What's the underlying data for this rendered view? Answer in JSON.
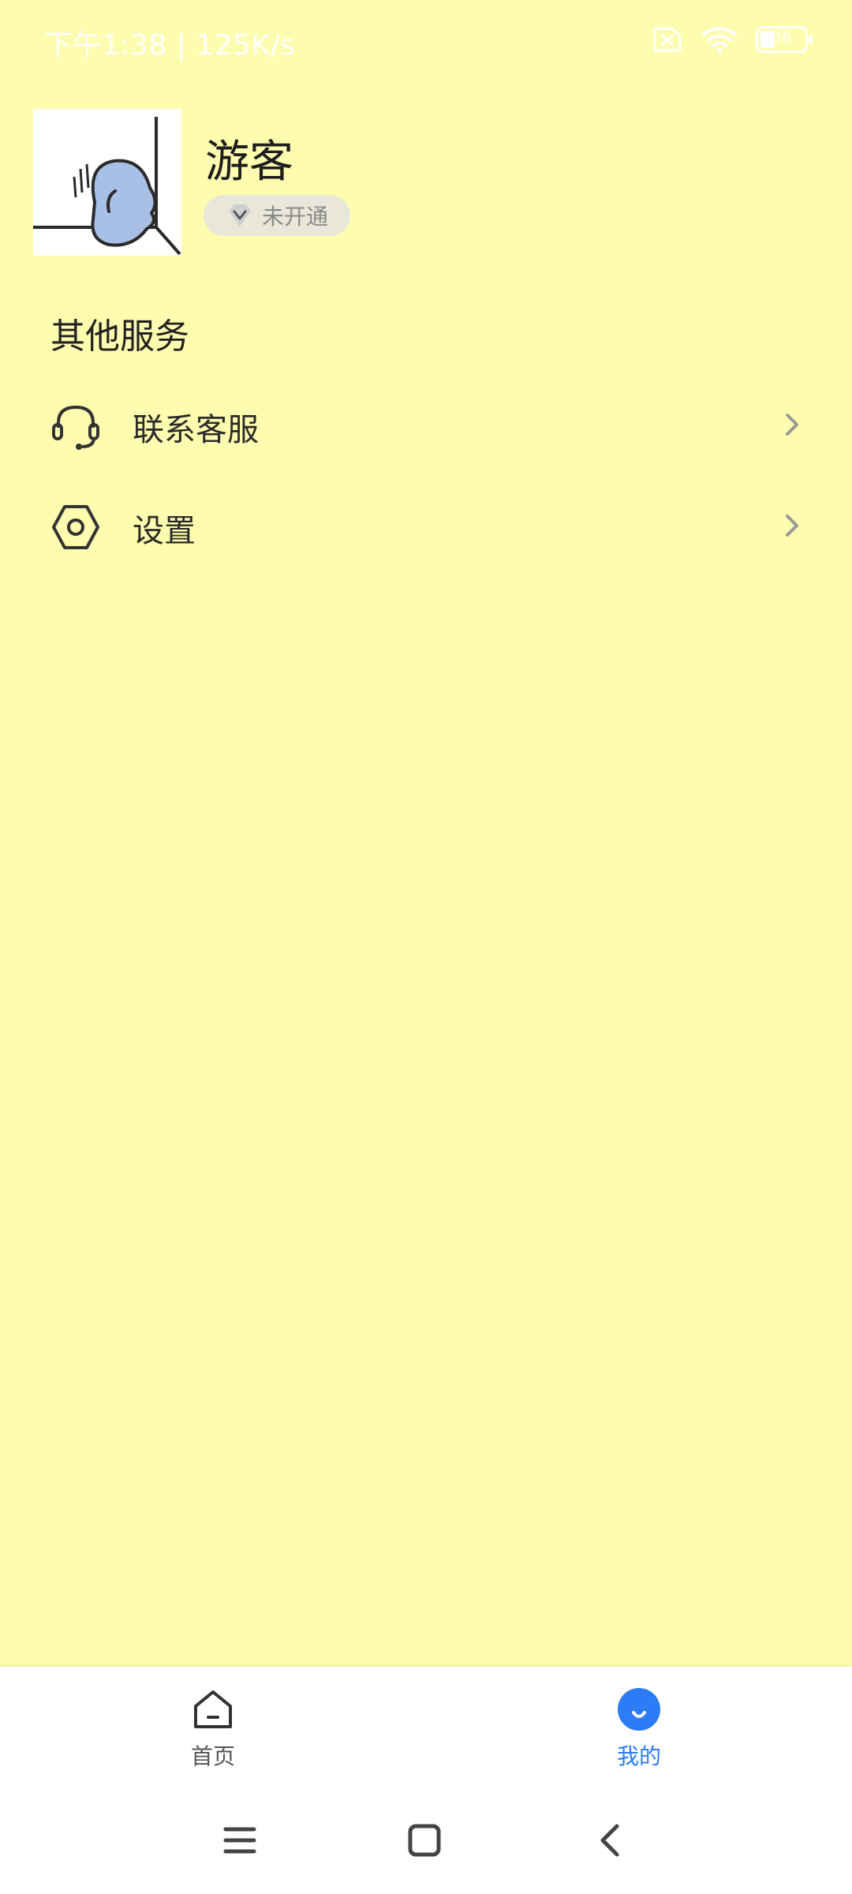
{
  "status_bar": {
    "time_speed": "下午1:38 | 125K/s",
    "battery_level": "36",
    "icons": [
      "sim-off-icon",
      "wifi-icon",
      "battery-icon"
    ]
  },
  "profile": {
    "username": "游客",
    "vip_status": "未开通",
    "vip_icon": "diamond-icon"
  },
  "services": {
    "title": "其他服务",
    "items": [
      {
        "label": "联系客服",
        "icon": "headset-icon"
      },
      {
        "label": "设置",
        "icon": "settings-hexagon-icon"
      }
    ]
  },
  "tabbar": {
    "tabs": [
      {
        "label": "首页",
        "icon": "home-icon",
        "active": false
      },
      {
        "label": "我的",
        "icon": "profile-icon",
        "active": true
      }
    ],
    "active_color": "#2B7CF6",
    "inactive_color": "#555555"
  },
  "nav_bar": {
    "buttons": [
      "menu-icon",
      "home-square-icon",
      "back-icon"
    ]
  },
  "colors": {
    "background": "#FEFCAE",
    "avatar_blob": "#A9C0E6"
  }
}
